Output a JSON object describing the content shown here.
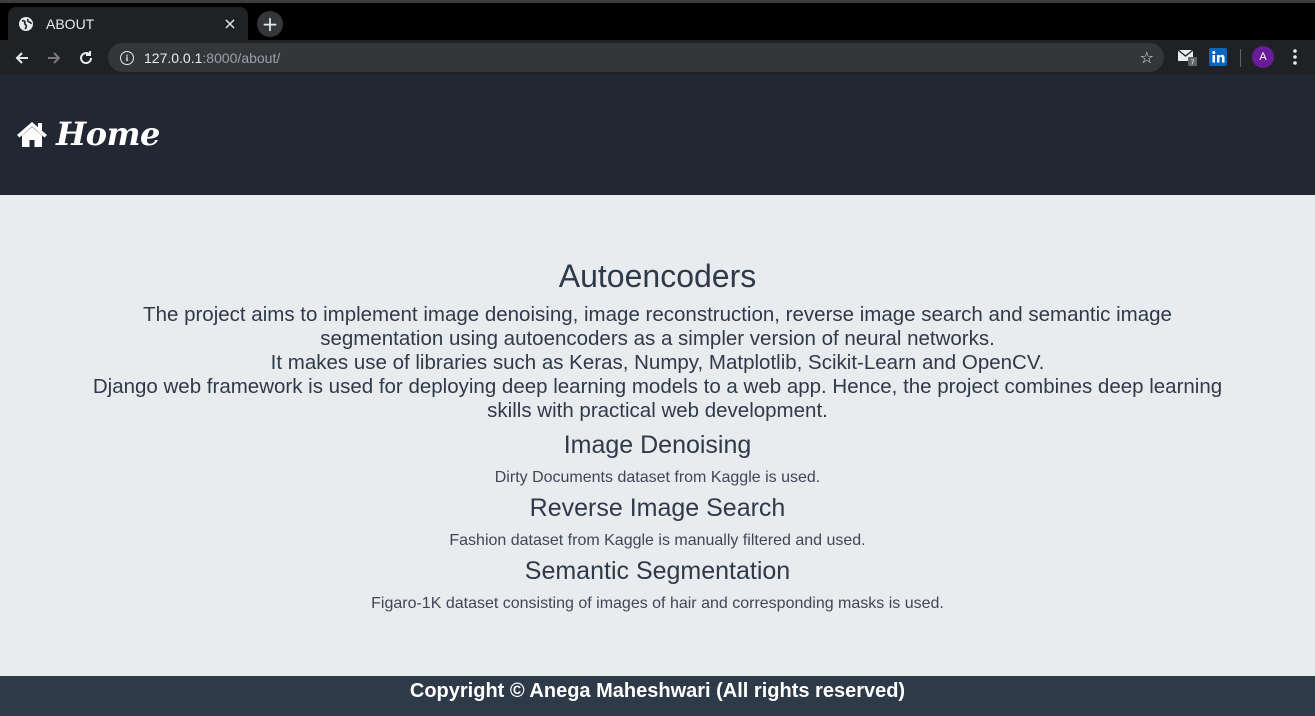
{
  "browser": {
    "tab_title": "ABOUT",
    "tab_close": "×",
    "new_tab": "+",
    "url_host": "127.0.0.1",
    "url_path": ":8000/about/",
    "profile_initial": "A",
    "icons": {
      "tab": "globe-icon",
      "back": "back-arrow-icon",
      "forward": "forward-arrow-icon",
      "reload": "reload-icon",
      "info": "info-icon",
      "bookmark": "star-icon",
      "ext_mail": "mail-extension-icon",
      "ext_linkedin": "linkedin-extension-icon",
      "menu": "kebab-menu-icon"
    }
  },
  "header": {
    "home_label": "Home",
    "home_icon": "house-icon"
  },
  "main": {
    "title": "Autoencoders",
    "intro": [
      "The project aims to implement image denoising, image reconstruction, reverse image search and semantic image segmentation using autoencoders as a simpler version of neural networks.",
      "It makes use of libraries such as Keras, Numpy, Matplotlib, Scikit-Learn and OpenCV.",
      "Django web framework is used for deploying deep learning models to a web app. Hence, the project combines deep learning skills with practical web development."
    ],
    "sections": [
      {
        "title": "Image Denoising",
        "desc": "Dirty Documents dataset from Kaggle is used."
      },
      {
        "title": "Reverse Image Search",
        "desc": "Fashion dataset from Kaggle is manually filtered and used."
      },
      {
        "title": "Semantic Segmentation",
        "desc": "Figaro-1K dataset consisting of images of hair and corresponding masks is used."
      }
    ]
  },
  "footer": {
    "text": "Copyright © Anega Maheshwari (All rights reserved)"
  },
  "colors": {
    "header_bg": "#222833",
    "page_bg": "#e8ecef",
    "text": "#2f3a49",
    "footer_bg": "#2f3a49",
    "avatar": "#6a1b9a"
  }
}
